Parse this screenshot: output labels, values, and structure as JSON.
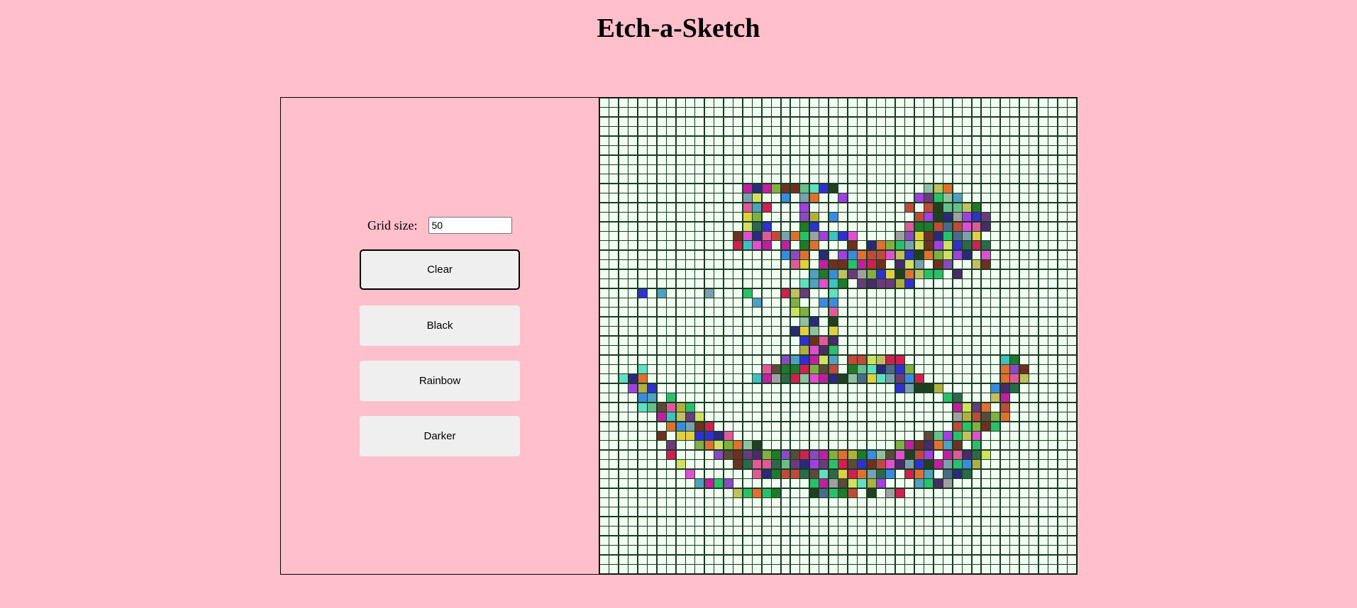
{
  "app": {
    "title": "Etch-a-Sketch"
  },
  "controls": {
    "grid_size_label": "Grid size:",
    "grid_size_value": "50",
    "buttons": [
      {
        "id": "clear",
        "label": "Clear",
        "focused": true
      },
      {
        "id": "black",
        "label": "Black",
        "focused": false
      },
      {
        "id": "rainbow",
        "label": "Rainbow",
        "focused": false
      },
      {
        "id": "darker",
        "label": "Darker",
        "focused": false
      }
    ]
  },
  "grid": {
    "size": 50,
    "empty_color": "#f0fff0",
    "line_color": "#1b3a24",
    "painted_cells": [
      [
        9,
        15
      ],
      [
        9,
        16
      ],
      [
        9,
        17
      ],
      [
        9,
        18
      ],
      [
        9,
        19
      ],
      [
        9,
        20
      ],
      [
        9,
        21
      ],
      [
        9,
        22
      ],
      [
        9,
        23
      ],
      [
        9,
        24
      ],
      [
        9,
        34
      ],
      [
        9,
        35
      ],
      [
        9,
        36
      ],
      [
        10,
        15
      ],
      [
        10,
        16
      ],
      [
        10,
        19
      ],
      [
        10,
        21
      ],
      [
        10,
        22
      ],
      [
        10,
        25
      ],
      [
        10,
        33
      ],
      [
        10,
        34
      ],
      [
        10,
        35
      ],
      [
        10,
        36
      ],
      [
        10,
        37
      ],
      [
        11,
        15
      ],
      [
        11,
        16
      ],
      [
        11,
        17
      ],
      [
        11,
        21
      ],
      [
        11,
        32
      ],
      [
        11,
        34
      ],
      [
        11,
        35
      ],
      [
        11,
        36
      ],
      [
        11,
        37
      ],
      [
        11,
        38
      ],
      [
        11,
        39
      ],
      [
        12,
        15
      ],
      [
        12,
        16
      ],
      [
        12,
        21
      ],
      [
        12,
        22
      ],
      [
        12,
        24
      ],
      [
        12,
        33
      ],
      [
        12,
        34
      ],
      [
        12,
        35
      ],
      [
        12,
        36
      ],
      [
        12,
        37
      ],
      [
        12,
        38
      ],
      [
        12,
        39
      ],
      [
        12,
        40
      ],
      [
        13,
        15
      ],
      [
        13,
        16
      ],
      [
        13,
        17
      ],
      [
        13,
        21
      ],
      [
        13,
        22
      ],
      [
        13,
        32
      ],
      [
        13,
        33
      ],
      [
        13,
        34
      ],
      [
        13,
        35
      ],
      [
        13,
        36
      ],
      [
        13,
        37
      ],
      [
        13,
        38
      ],
      [
        13,
        39
      ],
      [
        13,
        40
      ],
      [
        14,
        14
      ],
      [
        14,
        15
      ],
      [
        14,
        16
      ],
      [
        14,
        17
      ],
      [
        14,
        18
      ],
      [
        14,
        19
      ],
      [
        14,
        20
      ],
      [
        14,
        21
      ],
      [
        14,
        22
      ],
      [
        14,
        23
      ],
      [
        14,
        24
      ],
      [
        14,
        25
      ],
      [
        14,
        26
      ],
      [
        14,
        31
      ],
      [
        14,
        32
      ],
      [
        14,
        33
      ],
      [
        14,
        34
      ],
      [
        14,
        35
      ],
      [
        14,
        36
      ],
      [
        14,
        37
      ],
      [
        14,
        38
      ],
      [
        14,
        39
      ],
      [
        15,
        14
      ],
      [
        15,
        15
      ],
      [
        15,
        16
      ],
      [
        15,
        17
      ],
      [
        15,
        19
      ],
      [
        15,
        21
      ],
      [
        15,
        22
      ],
      [
        15,
        26
      ],
      [
        15,
        28
      ],
      [
        15,
        29
      ],
      [
        15,
        30
      ],
      [
        15,
        31
      ],
      [
        15,
        32
      ],
      [
        15,
        33
      ],
      [
        15,
        34
      ],
      [
        15,
        35
      ],
      [
        15,
        36
      ],
      [
        15,
        37
      ],
      [
        15,
        38
      ],
      [
        15,
        39
      ],
      [
        15,
        40
      ],
      [
        16,
        19
      ],
      [
        16,
        20
      ],
      [
        16,
        21
      ],
      [
        16,
        23
      ],
      [
        16,
        25
      ],
      [
        16,
        26
      ],
      [
        16,
        27
      ],
      [
        16,
        28
      ],
      [
        16,
        29
      ],
      [
        16,
        30
      ],
      [
        16,
        31
      ],
      [
        16,
        32
      ],
      [
        16,
        33
      ],
      [
        16,
        34
      ],
      [
        16,
        35
      ],
      [
        16,
        36
      ],
      [
        16,
        37
      ],
      [
        16,
        38
      ],
      [
        16,
        40
      ],
      [
        17,
        20
      ],
      [
        17,
        21
      ],
      [
        17,
        23
      ],
      [
        17,
        24
      ],
      [
        17,
        25
      ],
      [
        17,
        26
      ],
      [
        17,
        27
      ],
      [
        17,
        28
      ],
      [
        17,
        29
      ],
      [
        17,
        31
      ],
      [
        17,
        32
      ],
      [
        17,
        33
      ],
      [
        17,
        35
      ],
      [
        17,
        36
      ],
      [
        17,
        39
      ],
      [
        17,
        40
      ],
      [
        18,
        22
      ],
      [
        18,
        23
      ],
      [
        18,
        24
      ],
      [
        18,
        25
      ],
      [
        18,
        26
      ],
      [
        18,
        27
      ],
      [
        18,
        28
      ],
      [
        18,
        29
      ],
      [
        18,
        30
      ],
      [
        18,
        31
      ],
      [
        18,
        32
      ],
      [
        18,
        33
      ],
      [
        18,
        34
      ],
      [
        18,
        35
      ],
      [
        18,
        37
      ],
      [
        19,
        21
      ],
      [
        19,
        22
      ],
      [
        19,
        23
      ],
      [
        19,
        24
      ],
      [
        19,
        25
      ],
      [
        19,
        27
      ],
      [
        19,
        28
      ],
      [
        19,
        29
      ],
      [
        19,
        30
      ],
      [
        19,
        31
      ],
      [
        19,
        32
      ],
      [
        20,
        4
      ],
      [
        20,
        6
      ],
      [
        20,
        11
      ],
      [
        20,
        15
      ],
      [
        20,
        19
      ],
      [
        20,
        20
      ],
      [
        20,
        21
      ],
      [
        20,
        24
      ],
      [
        21,
        16
      ],
      [
        21,
        20
      ],
      [
        21,
        23
      ],
      [
        21,
        24
      ],
      [
        22,
        20
      ],
      [
        22,
        21
      ],
      [
        22,
        24
      ],
      [
        23,
        21
      ],
      [
        23,
        22
      ],
      [
        23,
        24
      ],
      [
        24,
        20
      ],
      [
        24,
        21
      ],
      [
        24,
        22
      ],
      [
        24,
        24
      ],
      [
        25,
        21
      ],
      [
        25,
        22
      ],
      [
        25,
        23
      ],
      [
        25,
        24
      ],
      [
        26,
        21
      ],
      [
        26,
        22
      ],
      [
        26,
        23
      ],
      [
        26,
        24
      ],
      [
        27,
        19
      ],
      [
        27,
        20
      ],
      [
        27,
        21
      ],
      [
        27,
        22
      ],
      [
        27,
        23
      ],
      [
        27,
        24
      ],
      [
        27,
        26
      ],
      [
        27,
        27
      ],
      [
        27,
        28
      ],
      [
        27,
        29
      ],
      [
        27,
        30
      ],
      [
        27,
        31
      ],
      [
        27,
        42
      ],
      [
        27,
        43
      ],
      [
        28,
        4
      ],
      [
        28,
        17
      ],
      [
        28,
        18
      ],
      [
        28,
        19
      ],
      [
        28,
        20
      ],
      [
        28,
        21
      ],
      [
        28,
        22
      ],
      [
        28,
        23
      ],
      [
        28,
        24
      ],
      [
        28,
        26
      ],
      [
        28,
        27
      ],
      [
        28,
        28
      ],
      [
        28,
        29
      ],
      [
        28,
        30
      ],
      [
        28,
        31
      ],
      [
        28,
        32
      ],
      [
        28,
        42
      ],
      [
        28,
        43
      ],
      [
        28,
        44
      ],
      [
        29,
        2
      ],
      [
        29,
        3
      ],
      [
        29,
        4
      ],
      [
        29,
        16
      ],
      [
        29,
        17
      ],
      [
        29,
        18
      ],
      [
        29,
        19
      ],
      [
        29,
        20
      ],
      [
        29,
        21
      ],
      [
        29,
        22
      ],
      [
        29,
        23
      ],
      [
        29,
        24
      ],
      [
        29,
        25
      ],
      [
        29,
        26
      ],
      [
        29,
        27
      ],
      [
        29,
        28
      ],
      [
        29,
        29
      ],
      [
        29,
        30
      ],
      [
        29,
        31
      ],
      [
        29,
        32
      ],
      [
        29,
        33
      ],
      [
        29,
        42
      ],
      [
        29,
        43
      ],
      [
        29,
        44
      ],
      [
        30,
        3
      ],
      [
        30,
        4
      ],
      [
        30,
        5
      ],
      [
        30,
        31
      ],
      [
        30,
        32
      ],
      [
        30,
        33
      ],
      [
        30,
        34
      ],
      [
        30,
        35
      ],
      [
        30,
        41
      ],
      [
        30,
        42
      ],
      [
        30,
        43
      ],
      [
        31,
        4
      ],
      [
        31,
        5
      ],
      [
        31,
        7
      ],
      [
        31,
        36
      ],
      [
        31,
        37
      ],
      [
        31,
        41
      ],
      [
        31,
        42
      ],
      [
        32,
        4
      ],
      [
        32,
        5
      ],
      [
        32,
        6
      ],
      [
        32,
        7
      ],
      [
        32,
        8
      ],
      [
        32,
        9
      ],
      [
        32,
        37
      ],
      [
        32,
        38
      ],
      [
        32,
        39
      ],
      [
        32,
        40
      ],
      [
        32,
        42
      ],
      [
        33,
        6
      ],
      [
        33,
        7
      ],
      [
        33,
        8
      ],
      [
        33,
        9
      ],
      [
        33,
        10
      ],
      [
        33,
        37
      ],
      [
        33,
        38
      ],
      [
        33,
        39
      ],
      [
        33,
        40
      ],
      [
        33,
        41
      ],
      [
        33,
        42
      ],
      [
        34,
        7
      ],
      [
        34,
        8
      ],
      [
        34,
        9
      ],
      [
        34,
        10
      ],
      [
        34,
        11
      ],
      [
        34,
        37
      ],
      [
        34,
        38
      ],
      [
        34,
        39
      ],
      [
        34,
        40
      ],
      [
        34,
        41
      ],
      [
        35,
        6
      ],
      [
        35,
        8
      ],
      [
        35,
        9
      ],
      [
        35,
        10
      ],
      [
        35,
        11
      ],
      [
        35,
        12
      ],
      [
        35,
        13
      ],
      [
        35,
        34
      ],
      [
        35,
        35
      ],
      [
        35,
        36
      ],
      [
        35,
        37
      ],
      [
        35,
        38
      ],
      [
        35,
        39
      ],
      [
        36,
        7
      ],
      [
        36,
        10
      ],
      [
        36,
        11
      ],
      [
        36,
        12
      ],
      [
        36,
        13
      ],
      [
        36,
        14
      ],
      [
        36,
        15
      ],
      [
        36,
        16
      ],
      [
        36,
        31
      ],
      [
        36,
        32
      ],
      [
        36,
        33
      ],
      [
        36,
        34
      ],
      [
        36,
        35
      ],
      [
        36,
        36
      ],
      [
        36,
        37
      ],
      [
        36,
        39
      ],
      [
        37,
        7
      ],
      [
        37,
        12
      ],
      [
        37,
        13
      ],
      [
        37,
        14
      ],
      [
        37,
        15
      ],
      [
        37,
        16
      ],
      [
        37,
        17
      ],
      [
        37,
        18
      ],
      [
        37,
        19
      ],
      [
        37,
        20
      ],
      [
        37,
        21
      ],
      [
        37,
        22
      ],
      [
        37,
        23
      ],
      [
        37,
        24
      ],
      [
        37,
        25
      ],
      [
        37,
        26
      ],
      [
        37,
        27
      ],
      [
        37,
        28
      ],
      [
        37,
        29
      ],
      [
        37,
        30
      ],
      [
        37,
        31
      ],
      [
        37,
        32
      ],
      [
        37,
        33
      ],
      [
        37,
        34
      ],
      [
        37,
        36
      ],
      [
        37,
        37
      ],
      [
        37,
        38
      ],
      [
        37,
        39
      ],
      [
        37,
        40
      ],
      [
        38,
        8
      ],
      [
        38,
        14
      ],
      [
        38,
        15
      ],
      [
        38,
        16
      ],
      [
        38,
        17
      ],
      [
        38,
        18
      ],
      [
        38,
        19
      ],
      [
        38,
        20
      ],
      [
        38,
        21
      ],
      [
        38,
        22
      ],
      [
        38,
        23
      ],
      [
        38,
        24
      ],
      [
        38,
        25
      ],
      [
        38,
        26
      ],
      [
        38,
        27
      ],
      [
        38,
        28
      ],
      [
        38,
        29
      ],
      [
        38,
        30
      ],
      [
        38,
        31
      ],
      [
        38,
        32
      ],
      [
        38,
        33
      ],
      [
        38,
        34
      ],
      [
        38,
        35
      ],
      [
        38,
        36
      ],
      [
        38,
        37
      ],
      [
        38,
        38
      ],
      [
        38,
        39
      ],
      [
        39,
        9
      ],
      [
        39,
        16
      ],
      [
        39,
        17
      ],
      [
        39,
        18
      ],
      [
        39,
        19
      ],
      [
        39,
        20
      ],
      [
        39,
        21
      ],
      [
        39,
        22
      ],
      [
        39,
        23
      ],
      [
        39,
        24
      ],
      [
        39,
        25
      ],
      [
        39,
        26
      ],
      [
        39,
        27
      ],
      [
        39,
        28
      ],
      [
        39,
        29
      ],
      [
        39,
        30
      ],
      [
        39,
        32
      ],
      [
        39,
        33
      ],
      [
        39,
        34
      ],
      [
        39,
        36
      ],
      [
        39,
        37
      ],
      [
        39,
        38
      ],
      [
        40,
        10
      ],
      [
        40,
        11
      ],
      [
        40,
        12
      ],
      [
        40,
        13
      ],
      [
        40,
        22
      ],
      [
        40,
        23
      ],
      [
        40,
        24
      ],
      [
        40,
        25
      ],
      [
        40,
        26
      ],
      [
        40,
        27
      ],
      [
        40,
        28
      ],
      [
        40,
        29
      ],
      [
        40,
        33
      ],
      [
        40,
        34
      ],
      [
        40,
        35
      ],
      [
        40,
        36
      ],
      [
        41,
        14
      ],
      [
        41,
        15
      ],
      [
        41,
        16
      ],
      [
        41,
        17
      ],
      [
        41,
        18
      ],
      [
        41,
        22
      ],
      [
        41,
        23
      ],
      [
        41,
        24
      ],
      [
        41,
        25
      ],
      [
        41,
        26
      ],
      [
        41,
        28
      ],
      [
        41,
        30
      ],
      [
        41,
        31
      ]
    ]
  }
}
